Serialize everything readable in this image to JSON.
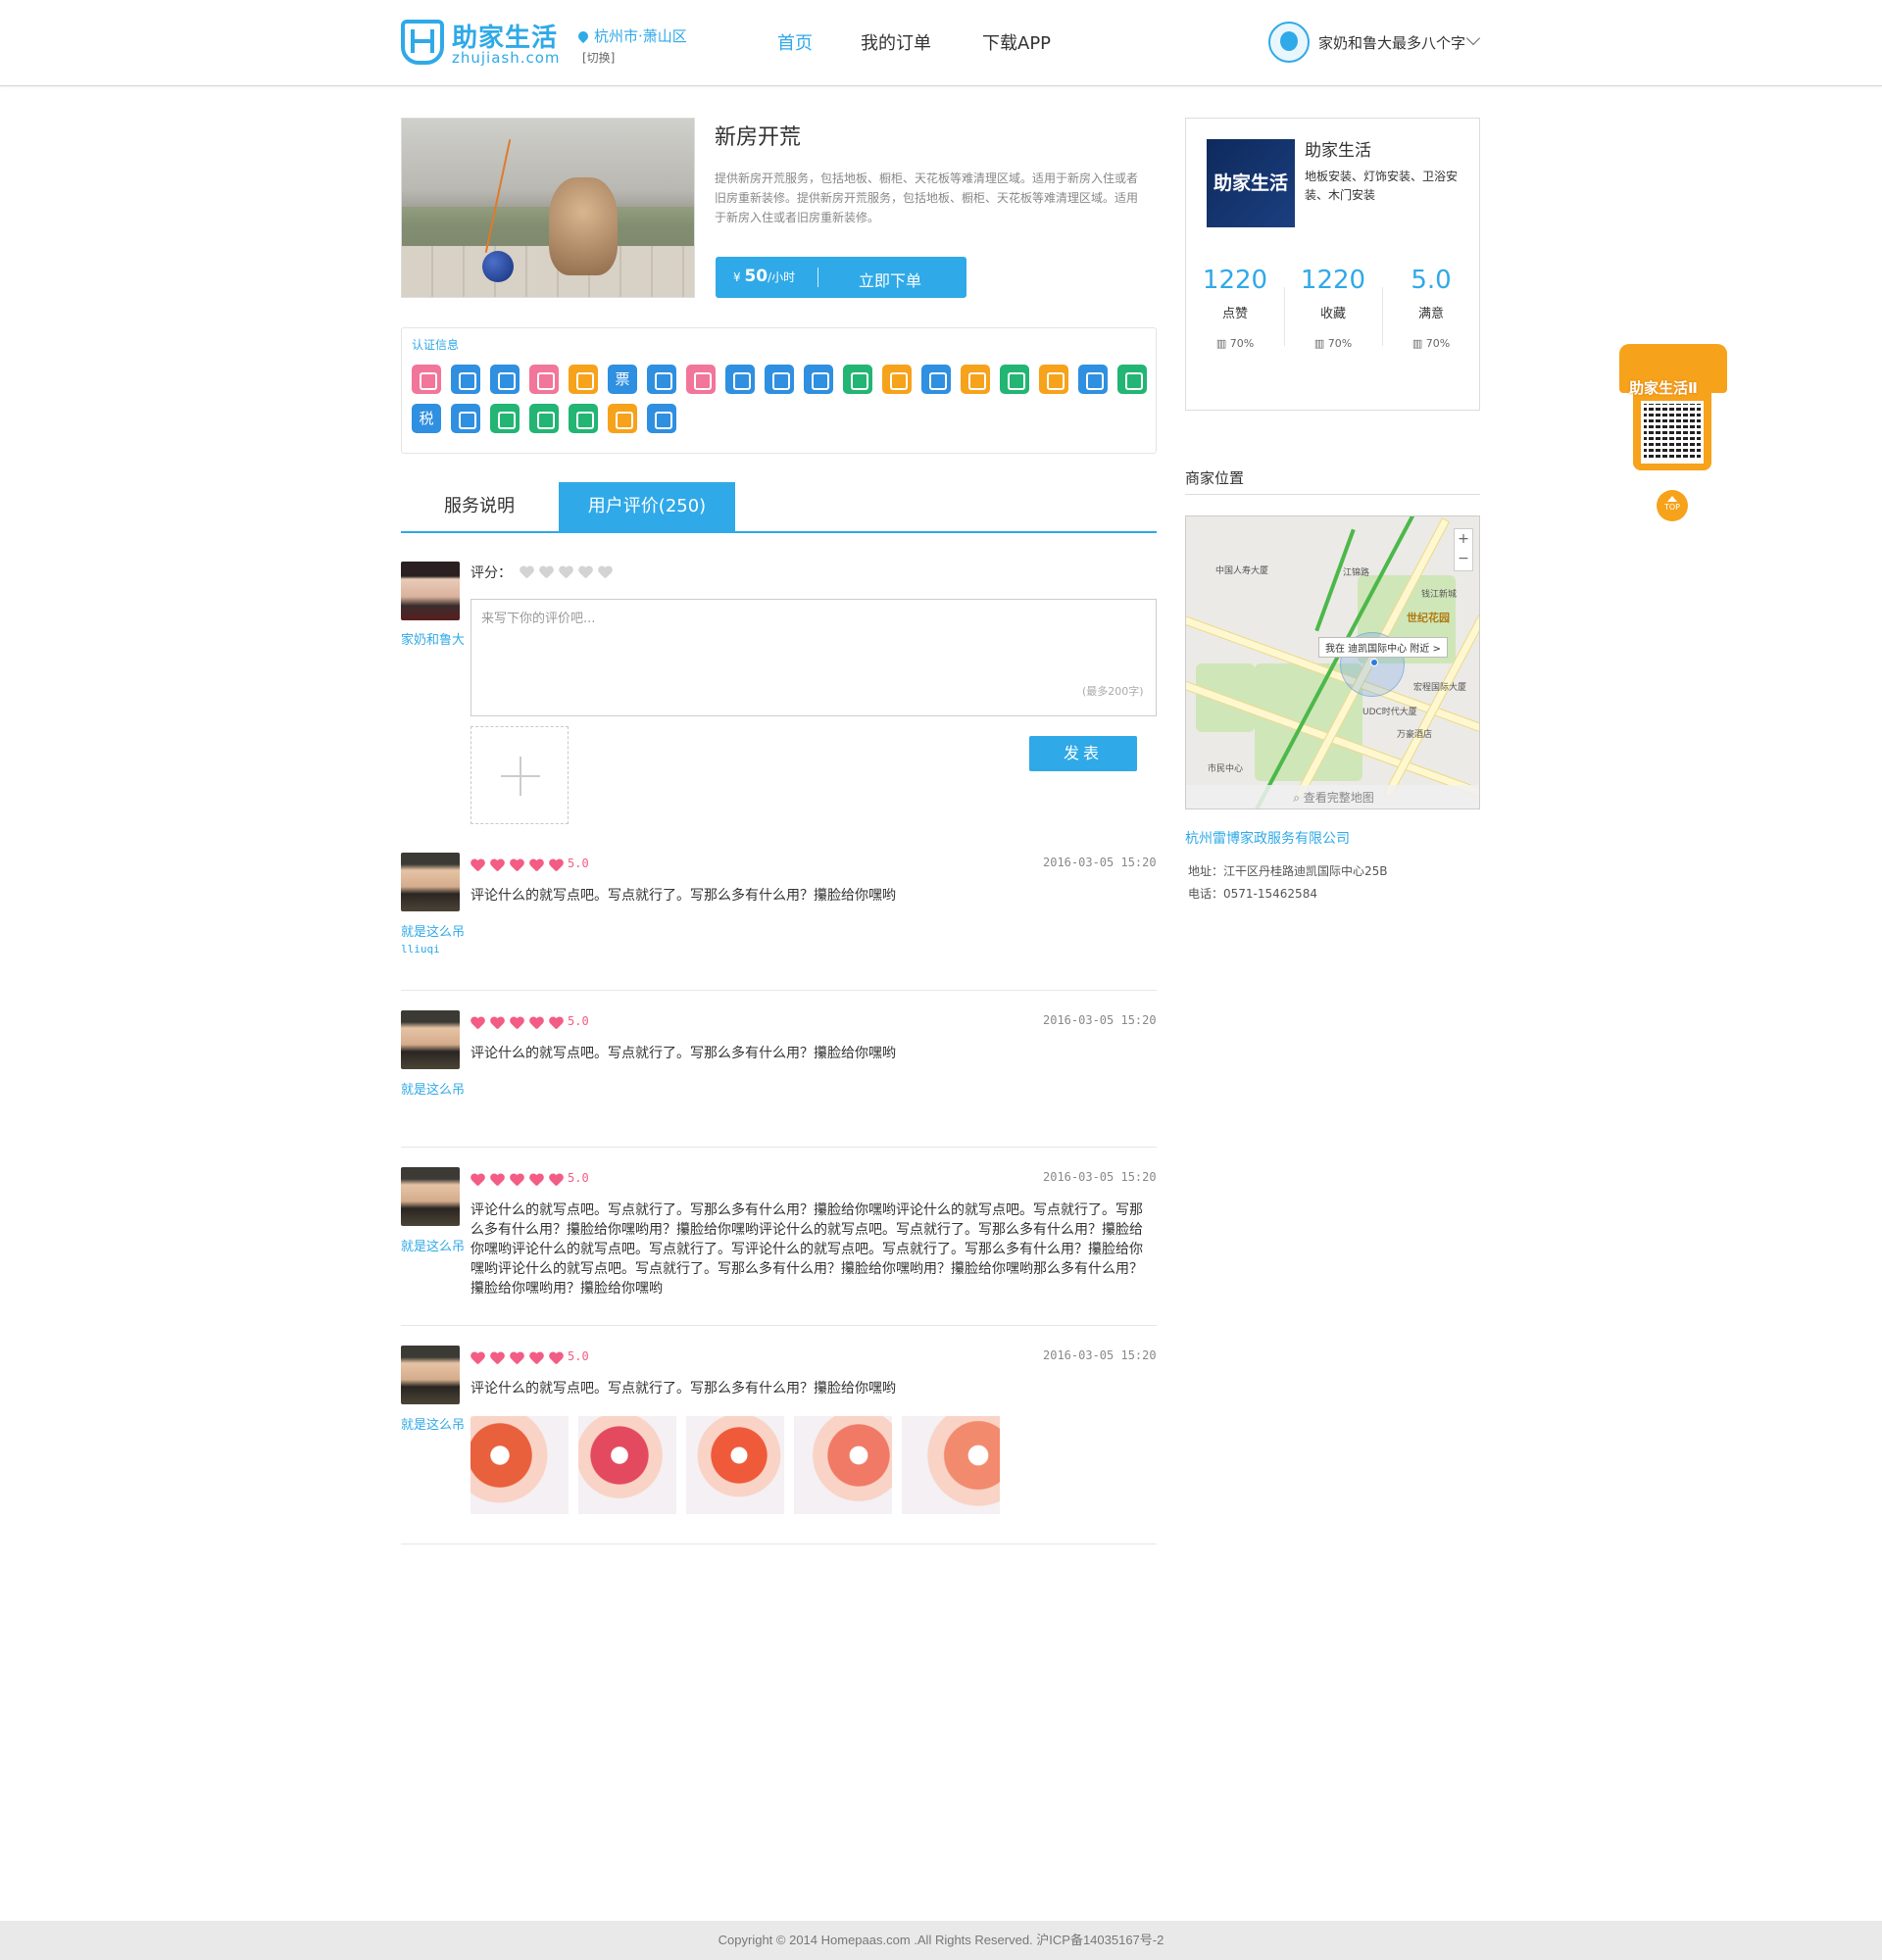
{
  "header": {
    "logo_cn": "助家生活",
    "logo_en": "zhujiash.com",
    "city": "杭州市·萧山区",
    "city_switch": "[切换]",
    "nav": [
      {
        "label": "首页",
        "active": true
      },
      {
        "label": "我的订单",
        "active": false
      },
      {
        "label": "下载APP",
        "active": false
      }
    ],
    "user_name": "家奶和鲁大最多八个字"
  },
  "service": {
    "title": "新房开荒",
    "description": "提供新房开荒服务，包括地板、橱柜、天花板等难清理区域。适用于新房入住或者旧房重新装修。提供新房开荒服务，包括地板、橱柜、天花板等难清理区域。适用于新房入住或者旧房重新装修。",
    "price_symbol": "¥",
    "price": "50",
    "price_unit": "/小时",
    "order_label": "立即下单"
  },
  "certification": {
    "title": "认证信息",
    "icons": [
      {
        "name": "nurse-icon",
        "color": "#f2759a",
        "text": ""
      },
      {
        "name": "org-chart-icon",
        "color": "#2f8fe0",
        "text": ""
      },
      {
        "name": "id-card-icon",
        "color": "#2f8fe0",
        "text": ""
      },
      {
        "name": "baby-icon",
        "color": "#f2759a",
        "text": ""
      },
      {
        "name": "bottle-icon",
        "color": "#f7a21b",
        "text": ""
      },
      {
        "name": "ticket-icon",
        "color": "#2f8fe0",
        "text": "票"
      },
      {
        "name": "phone-icon",
        "color": "#2f8fe0",
        "text": ""
      },
      {
        "name": "medical-icon",
        "color": "#f2759a",
        "text": ""
      },
      {
        "name": "certificate-icon",
        "color": "#2f8fe0",
        "text": ""
      },
      {
        "name": "profile-card-icon",
        "color": "#2f8fe0",
        "text": ""
      },
      {
        "name": "license-icon",
        "color": "#2f8fe0",
        "text": ""
      },
      {
        "name": "cleaner-icon",
        "color": "#22b573",
        "text": ""
      },
      {
        "name": "shop-icon",
        "color": "#f7a21b",
        "text": ""
      },
      {
        "name": "briefcase-icon",
        "color": "#2f8fe0",
        "text": ""
      },
      {
        "name": "worker-icon",
        "color": "#f7a21b",
        "text": ""
      },
      {
        "name": "fridge-icon",
        "color": "#22b573",
        "text": ""
      },
      {
        "name": "fitness-icon",
        "color": "#f7a21b",
        "text": ""
      },
      {
        "name": "wrench-icon",
        "color": "#2f8fe0",
        "text": ""
      },
      {
        "name": "bucket-icon",
        "color": "#22b573",
        "text": ""
      },
      {
        "name": "tax-icon",
        "color": "#2f8fe0",
        "text": "税"
      },
      {
        "name": "lock-icon",
        "color": "#2f8fe0",
        "text": ""
      },
      {
        "name": "cashier-icon",
        "color": "#22b573",
        "text": ""
      },
      {
        "name": "handshake-icon",
        "color": "#22b573",
        "text": ""
      },
      {
        "name": "star-badge-icon",
        "color": "#22b573",
        "text": ""
      },
      {
        "name": "payment-icon",
        "color": "#f7a21b",
        "text": ""
      },
      {
        "name": "settings-icon",
        "color": "#2f8fe0",
        "text": ""
      }
    ]
  },
  "tabs": [
    {
      "label": "服务说明",
      "active": false
    },
    {
      "label": "用户评价(250)",
      "active": true
    }
  ],
  "comment_form": {
    "user_name": "家奶和鲁大",
    "rate_label": "评分：",
    "placeholder": "来写下你的评价吧...",
    "max_hint": "(最多200字)",
    "publish_label": "发表"
  },
  "reviews": [
    {
      "name": "就是这么吊",
      "sub": "lliuqi",
      "rating": 5,
      "score": "5.0",
      "time": "2016-03-05 15:20",
      "text": "评论什么的就写点吧。写点就行了。写那么多有什么用？攥脸给你嘿哟",
      "images": 0
    },
    {
      "name": "就是这么吊",
      "sub": "",
      "rating": 5,
      "score": "5.0",
      "time": "2016-03-05 15:20",
      "text": "评论什么的就写点吧。写点就行了。写那么多有什么用？攥脸给你嘿哟",
      "images": 0
    },
    {
      "name": "就是这么吊",
      "sub": "",
      "rating": 5,
      "score": "5.0",
      "time": "2016-03-05 15:20",
      "text": "评论什么的就写点吧。写点就行了。写那么多有什么用？攥脸给你嘿哟评论什么的就写点吧。写点就行了。写那么多有什么用？攥脸给你嘿哟用？攥脸给你嘿哟评论什么的就写点吧。写点就行了。写那么多有什么用？攥脸给你嘿哟评论什么的就写点吧。写点就行了。写评论什么的就写点吧。写点就行了。写那么多有什么用？攥脸给你嘿哟评论什么的就写点吧。写点就行了。写那么多有什么用？攥脸给你嘿哟用？攥脸给你嘿哟那么多有什么用？攥脸给你嘿哟用？攥脸给你嘿哟",
      "images": 0
    },
    {
      "name": "就是这么吊",
      "sub": "",
      "rating": 5,
      "score": "5.0",
      "time": "2016-03-05 15:20",
      "text": "评论什么的就写点吧。写点就行了。写那么多有什么用？攥脸给你嘿哟",
      "images": 5
    }
  ],
  "merchant": {
    "logo_text": "助家生活",
    "name": "助家生活",
    "tags": "地板安装、灯饰安装、卫浴安装、木门安装",
    "stats": [
      {
        "value": "1220",
        "label": "点赞",
        "pct": "70%"
      },
      {
        "value": "1220",
        "label": "收藏",
        "pct": "70%"
      },
      {
        "value": "5.0",
        "label": "满意",
        "pct": "70%"
      }
    ]
  },
  "location": {
    "title": "商家位置",
    "map_bubble": "我在 迪凯国际中心 附近 >",
    "map_labels": {
      "l1": "江锦路",
      "l2": "世纪花园",
      "l3": "UDC时代大厦",
      "l4": "宏程国际大厦",
      "l5": "市民中心",
      "l6": "钱江新城",
      "l7": "万豪酒店",
      "l8": "中国人寿大厦"
    },
    "map_footer": "查看完整地图",
    "company": "杭州雷博家政服务有限公司",
    "address_label": "地址：",
    "address": "江干区丹桂路迪凯国际中心25B",
    "phone_label": "电话：",
    "phone": "0571-15462584"
  },
  "qr": {
    "brand": "助家生活Ⅱ",
    "top_label": "TOP"
  },
  "footer": {
    "copyright": "Copyright © 2014 Homepaas.com .All Rights Reserved. 沪ICP备14035167号-2"
  }
}
